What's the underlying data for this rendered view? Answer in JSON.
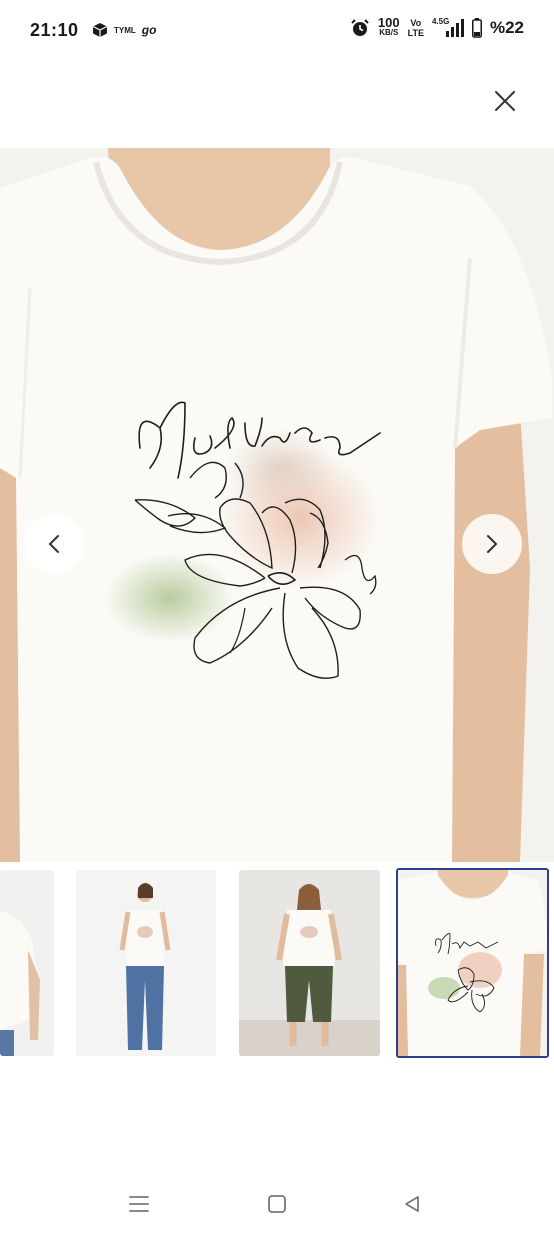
{
  "status_bar": {
    "time": "21:10",
    "app_badge": "TYML",
    "go_badge": "go",
    "speed_value": "100",
    "speed_unit": "KB/S",
    "volte_top": "Vo",
    "volte_bottom": "LTE",
    "network_type": "4.5G",
    "battery": "%22"
  },
  "product_gallery": {
    "close_icon": "close-icon",
    "prev_icon": "chevron-left-icon",
    "next_icon": "chevron-right-icon",
    "print_text": "Natural",
    "thumbnail_count": 4,
    "selected_thumbnail": 4
  },
  "system_nav": {
    "recents_icon": "recents-icon",
    "home_icon": "home-icon",
    "back_icon": "back-icon"
  },
  "colors": {
    "accent": "#2c3f8c",
    "shirt": "#fbfaf6",
    "skin": "#e7c5a8",
    "background": "#ffffff"
  }
}
